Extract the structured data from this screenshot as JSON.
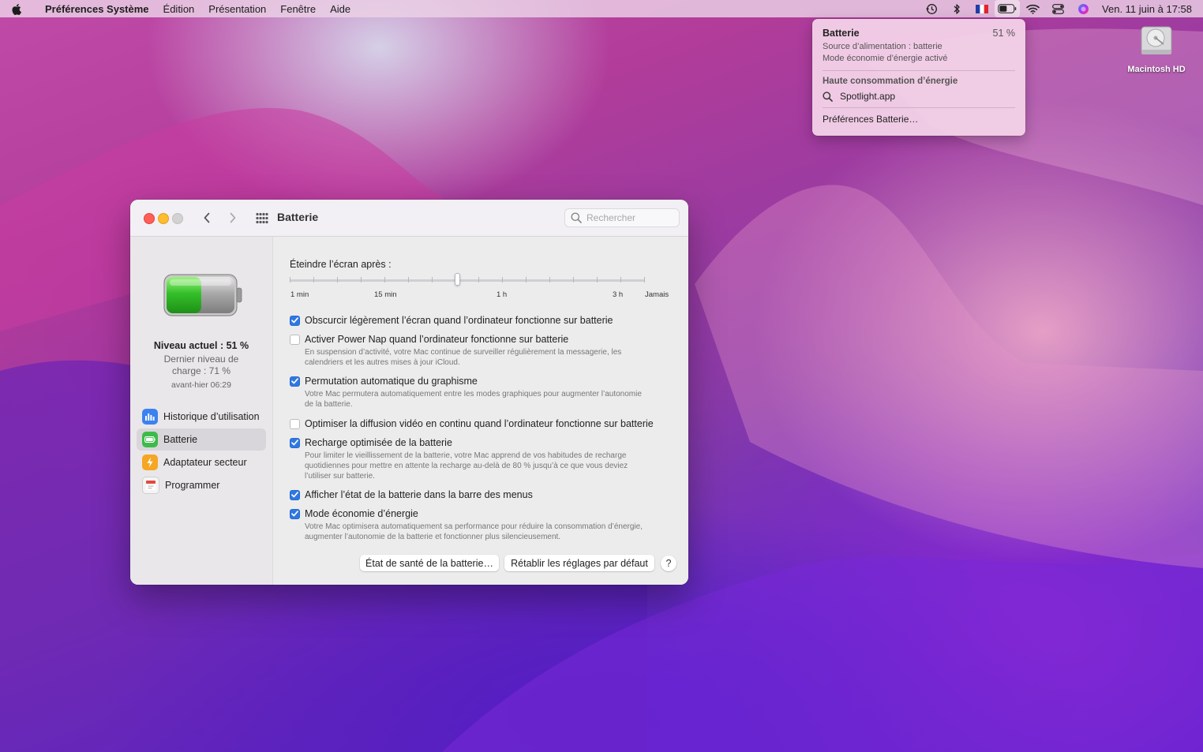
{
  "menubar": {
    "app_name": "Préférences Système",
    "menus": [
      "Édition",
      "Présentation",
      "Fenêtre",
      "Aide"
    ],
    "clock": "Ven. 11 juin à  17:58",
    "icons": [
      "time-machine-icon",
      "bluetooth-icon",
      "french-flag-icon",
      "battery-icon",
      "wifi-icon",
      "control-center-icon",
      "siri-icon"
    ]
  },
  "battery_menu": {
    "title": "Batterie",
    "percent": "51 %",
    "source": "Source d’alimentation : batterie",
    "mode": "Mode économie d’énergie activé",
    "section_title": "Haute consommation d’énergie",
    "app": "Spotlight.app",
    "link": "Préférences Batterie…"
  },
  "desktop": {
    "disk_label": "Macintosh HD"
  },
  "window": {
    "title": "Batterie",
    "search_placeholder": "Rechercher",
    "sidebar": {
      "level_main": "Niveau actuel : 51 %",
      "level_last_line1": "Dernier niveau de",
      "level_last_line2": "charge : 71 %",
      "level_time": "avant-hier 06:29",
      "charge_fraction": 0.51,
      "items": [
        {
          "label": "Historique d’utilisation",
          "icon": "usage-history-icon",
          "color": "#3b82f0",
          "selected": false
        },
        {
          "label": "Batterie",
          "icon": "battery-icon",
          "color": "#3dbb4a",
          "selected": true
        },
        {
          "label": "Adaptateur secteur",
          "icon": "power-adapter-icon",
          "color": "#f5a623",
          "selected": false
        },
        {
          "label": "Programmer",
          "icon": "calendar-icon",
          "color": "#f2f2f2",
          "selected": false
        }
      ]
    },
    "content": {
      "screen_off_label": "Éteindre l’écran après :",
      "slider_ticks": [
        "1 min",
        "15 min",
        "1 h",
        "3 h",
        "Jamais"
      ],
      "slider_value_fraction": 0.47,
      "options": [
        {
          "label": "Obscurcir légèrement l’écran quand l’ordinateur fonctionne sur batterie",
          "checked": true,
          "desc": ""
        },
        {
          "label": "Activer Power Nap quand l’ordinateur fonctionne sur batterie",
          "checked": false,
          "desc_line1": "En suspension d’activité, votre Mac continue de surveiller régulièrement la messagerie, les",
          "desc_line2": "calendriers et les autres mises à jour iCloud."
        },
        {
          "label": "Permutation automatique du graphisme",
          "checked": true,
          "desc_line1": "Votre Mac permutera automatiquement entre les modes graphiques pour augmenter l’autonomie",
          "desc_line2": "de la batterie."
        },
        {
          "label": "Optimiser la diffusion vidéo en continu quand l’ordinateur fonctionne sur batterie",
          "checked": false,
          "desc": ""
        },
        {
          "label": "Recharge optimisée de la batterie",
          "checked": true,
          "desc_line1": "Pour limiter le vieillissement de la batterie, votre Mac apprend de vos habitudes de recharge",
          "desc_line2": "quotidiennes pour mettre en attente la recharge au-delà de 80 % jusqu’à ce que vous deviez",
          "desc_line3": "l’utiliser sur batterie."
        },
        {
          "label": "Afficher l’état de la batterie dans la barre des menus",
          "checked": true,
          "desc": ""
        },
        {
          "label": "Mode économie d’énergie",
          "checked": true,
          "desc_line1": "Votre Mac optimisera automatiquement sa performance pour réduire la consommation d’énergie,",
          "desc_line2": "augmenter l’autonomie de la batterie et fonctionner plus silencieusement."
        }
      ],
      "buttons": {
        "health": "État de santé de la batterie…",
        "restore": "Rétablir les réglages par défaut",
        "help": "?"
      }
    }
  }
}
